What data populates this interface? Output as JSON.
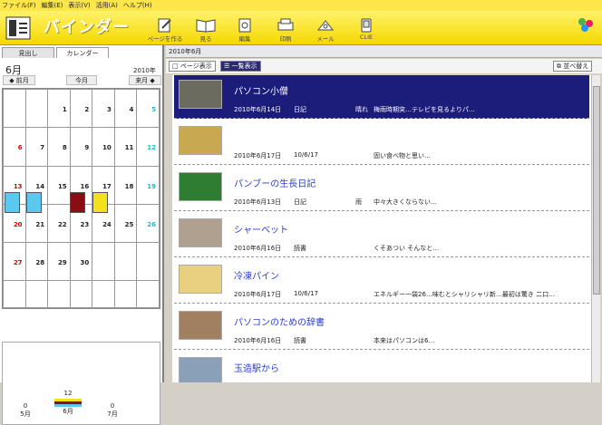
{
  "menu": [
    "ファイル(F)",
    "編集(E)",
    "表示(V)",
    "活用(A)",
    "ヘルプ(H)"
  ],
  "app": {
    "title": "バインダー"
  },
  "toolbar": [
    {
      "label": "ページを作る",
      "icon": "page-create-icon"
    },
    {
      "label": "見る",
      "icon": "book-view-icon"
    },
    {
      "label": "編集",
      "icon": "edit-icon"
    },
    {
      "label": "印刷",
      "icon": "printer-icon"
    },
    {
      "label": "メール",
      "icon": "mail-icon"
    },
    {
      "label": "CLIE",
      "icon": "clie-device-icon"
    }
  ],
  "left": {
    "tabs": [
      "見出し",
      "カレンダー"
    ],
    "month": "6月",
    "year": "2010年",
    "prev": "◆ 前月",
    "today": "今月",
    "next": "来月 ◆",
    "calendar_rows": [
      [
        "",
        "",
        "1",
        "2",
        "3",
        "4",
        "5"
      ],
      [
        "6",
        "7",
        "8",
        "9",
        "10",
        "11",
        "12"
      ],
      [
        "13",
        "14",
        "15",
        "16",
        "17",
        "18",
        "19"
      ],
      [
        "20",
        "21",
        "22",
        "23",
        "24",
        "25",
        "26"
      ],
      [
        "27",
        "28",
        "29",
        "30",
        "",
        "",
        ""
      ],
      [
        "",
        "",
        "",
        "",
        "",
        "",
        ""
      ]
    ],
    "stats": [
      {
        "month": "5月",
        "count": "0"
      },
      {
        "month": "6月",
        "count": "12"
      },
      {
        "month": "7月",
        "count": "0"
      }
    ]
  },
  "right": {
    "header": "2010年6月",
    "page_view": "ページ表示",
    "list_view": "一覧表示",
    "sort": "並べ替え"
  },
  "entries": [
    {
      "title": "パソコン小僧",
      "date": "2010年6月14日",
      "cat": "日記",
      "w": "晴れ",
      "body": "梅雨時期突…テレビを見るよりパ…"
    },
    {
      "title": "",
      "date": "2010年6月17日",
      "cat": "10/6/17",
      "w": "",
      "body": "固い食べ物と思い…"
    },
    {
      "title": "パンブーの生長日記",
      "date": "2010年6月13日",
      "cat": "日記",
      "w": "雨",
      "body": "中々大きくならない…"
    },
    {
      "title": "シャーベット",
      "date": "2010年6月16日",
      "cat": "読書",
      "w": "",
      "body": "くそあつい そんなと…"
    },
    {
      "title": "冷凍パイン",
      "date": "2010年6月17日",
      "cat": "10/6/17",
      "w": "",
      "body": "エネルギー一袋26…味むとシャリシャリ新…最初は驚き 二口…"
    },
    {
      "title": "パソコンのための辞書",
      "date": "2010年6月16日",
      "cat": "読書",
      "w": "",
      "body": "本来はパソコンは6…"
    },
    {
      "title": "玉造駅から",
      "date": "",
      "cat": "",
      "w": "",
      "body": ""
    }
  ]
}
